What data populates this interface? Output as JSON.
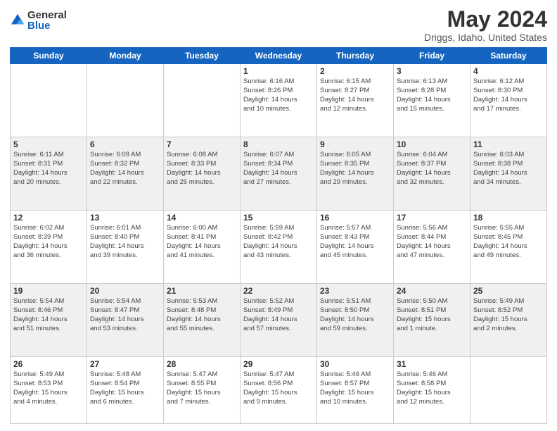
{
  "logo": {
    "general": "General",
    "blue": "Blue"
  },
  "title": "May 2024",
  "location": "Driggs, Idaho, United States",
  "days_of_week": [
    "Sunday",
    "Monday",
    "Tuesday",
    "Wednesday",
    "Thursday",
    "Friday",
    "Saturday"
  ],
  "weeks": [
    {
      "days": [
        {
          "num": "",
          "info": ""
        },
        {
          "num": "",
          "info": ""
        },
        {
          "num": "",
          "info": ""
        },
        {
          "num": "1",
          "info": "Sunrise: 6:16 AM\nSunset: 8:26 PM\nDaylight: 14 hours\nand 10 minutes."
        },
        {
          "num": "2",
          "info": "Sunrise: 6:15 AM\nSunset: 8:27 PM\nDaylight: 14 hours\nand 12 minutes."
        },
        {
          "num": "3",
          "info": "Sunrise: 6:13 AM\nSunset: 8:28 PM\nDaylight: 14 hours\nand 15 minutes."
        },
        {
          "num": "4",
          "info": "Sunrise: 6:12 AM\nSunset: 8:30 PM\nDaylight: 14 hours\nand 17 minutes."
        }
      ]
    },
    {
      "days": [
        {
          "num": "5",
          "info": "Sunrise: 6:11 AM\nSunset: 8:31 PM\nDaylight: 14 hours\nand 20 minutes."
        },
        {
          "num": "6",
          "info": "Sunrise: 6:09 AM\nSunset: 8:32 PM\nDaylight: 14 hours\nand 22 minutes."
        },
        {
          "num": "7",
          "info": "Sunrise: 6:08 AM\nSunset: 8:33 PM\nDaylight: 14 hours\nand 25 minutes."
        },
        {
          "num": "8",
          "info": "Sunrise: 6:07 AM\nSunset: 8:34 PM\nDaylight: 14 hours\nand 27 minutes."
        },
        {
          "num": "9",
          "info": "Sunrise: 6:05 AM\nSunset: 8:35 PM\nDaylight: 14 hours\nand 29 minutes."
        },
        {
          "num": "10",
          "info": "Sunrise: 6:04 AM\nSunset: 8:37 PM\nDaylight: 14 hours\nand 32 minutes."
        },
        {
          "num": "11",
          "info": "Sunrise: 6:03 AM\nSunset: 8:38 PM\nDaylight: 14 hours\nand 34 minutes."
        }
      ]
    },
    {
      "days": [
        {
          "num": "12",
          "info": "Sunrise: 6:02 AM\nSunset: 8:39 PM\nDaylight: 14 hours\nand 36 minutes."
        },
        {
          "num": "13",
          "info": "Sunrise: 6:01 AM\nSunset: 8:40 PM\nDaylight: 14 hours\nand 39 minutes."
        },
        {
          "num": "14",
          "info": "Sunrise: 6:00 AM\nSunset: 8:41 PM\nDaylight: 14 hours\nand 41 minutes."
        },
        {
          "num": "15",
          "info": "Sunrise: 5:59 AM\nSunset: 8:42 PM\nDaylight: 14 hours\nand 43 minutes."
        },
        {
          "num": "16",
          "info": "Sunrise: 5:57 AM\nSunset: 8:43 PM\nDaylight: 14 hours\nand 45 minutes."
        },
        {
          "num": "17",
          "info": "Sunrise: 5:56 AM\nSunset: 8:44 PM\nDaylight: 14 hours\nand 47 minutes."
        },
        {
          "num": "18",
          "info": "Sunrise: 5:55 AM\nSunset: 8:45 PM\nDaylight: 14 hours\nand 49 minutes."
        }
      ]
    },
    {
      "days": [
        {
          "num": "19",
          "info": "Sunrise: 5:54 AM\nSunset: 8:46 PM\nDaylight: 14 hours\nand 51 minutes."
        },
        {
          "num": "20",
          "info": "Sunrise: 5:54 AM\nSunset: 8:47 PM\nDaylight: 14 hours\nand 53 minutes."
        },
        {
          "num": "21",
          "info": "Sunrise: 5:53 AM\nSunset: 8:48 PM\nDaylight: 14 hours\nand 55 minutes."
        },
        {
          "num": "22",
          "info": "Sunrise: 5:52 AM\nSunset: 8:49 PM\nDaylight: 14 hours\nand 57 minutes."
        },
        {
          "num": "23",
          "info": "Sunrise: 5:51 AM\nSunset: 8:50 PM\nDaylight: 14 hours\nand 59 minutes."
        },
        {
          "num": "24",
          "info": "Sunrise: 5:50 AM\nSunset: 8:51 PM\nDaylight: 15 hours\nand 1 minute."
        },
        {
          "num": "25",
          "info": "Sunrise: 5:49 AM\nSunset: 8:52 PM\nDaylight: 15 hours\nand 2 minutes."
        }
      ]
    },
    {
      "days": [
        {
          "num": "26",
          "info": "Sunrise: 5:49 AM\nSunset: 8:53 PM\nDaylight: 15 hours\nand 4 minutes."
        },
        {
          "num": "27",
          "info": "Sunrise: 5:48 AM\nSunset: 8:54 PM\nDaylight: 15 hours\nand 6 minutes."
        },
        {
          "num": "28",
          "info": "Sunrise: 5:47 AM\nSunset: 8:55 PM\nDaylight: 15 hours\nand 7 minutes."
        },
        {
          "num": "29",
          "info": "Sunrise: 5:47 AM\nSunset: 8:56 PM\nDaylight: 15 hours\nand 9 minutes."
        },
        {
          "num": "30",
          "info": "Sunrise: 5:46 AM\nSunset: 8:57 PM\nDaylight: 15 hours\nand 10 minutes."
        },
        {
          "num": "31",
          "info": "Sunrise: 5:46 AM\nSunset: 8:58 PM\nDaylight: 15 hours\nand 12 minutes."
        },
        {
          "num": "",
          "info": ""
        }
      ]
    }
  ]
}
